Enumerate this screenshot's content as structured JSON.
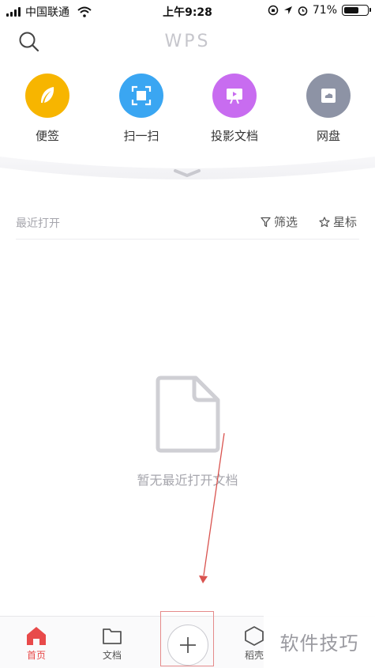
{
  "status_bar": {
    "carrier": "中国联通",
    "time": "上午9:28",
    "battery_percent": "71%",
    "battery_level": 0.71
  },
  "header": {
    "logo": "WPS"
  },
  "tools": [
    {
      "label": "便签",
      "icon": "feather-icon",
      "color": "#f7b500"
    },
    {
      "label": "扫一扫",
      "icon": "scan-icon",
      "color": "#3aa6f2"
    },
    {
      "label": "投影文档",
      "icon": "projector-icon",
      "color": "#c86cf0"
    },
    {
      "label": "网盘",
      "icon": "cloud-drive-icon",
      "color": "#8d93a5"
    }
  ],
  "recent": {
    "title": "最近打开",
    "filter_label": "筛选",
    "star_label": "星标"
  },
  "empty_state": {
    "text": "暂无最近打开文档"
  },
  "bottom_nav": {
    "home_label": "首页",
    "docs_label": "文档",
    "shell_label": "稻壳",
    "active_color": "#e84a4a"
  },
  "watermark": {
    "text": "软件技巧"
  }
}
